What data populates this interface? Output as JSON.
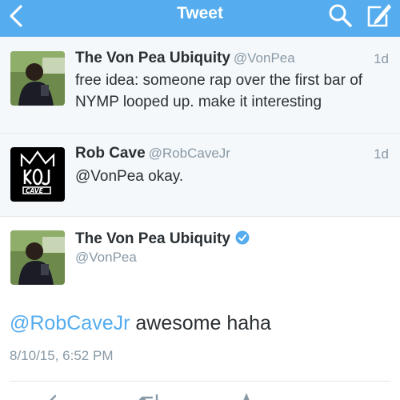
{
  "nav": {
    "title": "Tweet",
    "color": "#55acee"
  },
  "context_tweets": [
    {
      "name": "The Von Pea Ubiquity",
      "handle": "@VonPea",
      "time": "1d",
      "text": "free idea: someone rap over the first bar of NYMP looped up. make it interesting"
    },
    {
      "name": "Rob Cave",
      "handle": "@RobCaveJr",
      "time": "1d",
      "text": "@VonPea okay."
    }
  ],
  "main_tweet": {
    "name": "The Von Pea Ubiquity",
    "handle": "@VonPea",
    "verified": true,
    "mention": "@RobCaveJr",
    "text": " awesome haha",
    "timestamp": "8/10/15, 6:52 PM"
  },
  "icons": {
    "back": "chevron-left-icon",
    "search": "search-icon",
    "compose": "compose-icon",
    "verified": "verified-badge-icon",
    "reply": "reply-icon",
    "retweet": "retweet-icon",
    "favorite": "favorite-icon"
  },
  "colors": {
    "accent": "#55acee",
    "muted": "#8899a6",
    "text": "#292f33",
    "context_bg": "#f5f8fa"
  }
}
